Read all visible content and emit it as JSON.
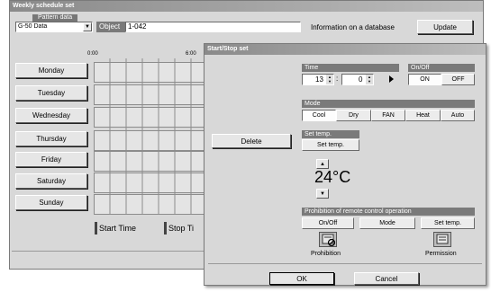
{
  "main_window": {
    "title": "Weekly schedule set",
    "pattern_label": "Pattern data",
    "pattern_value": "G-50 Data",
    "object_label": "Object",
    "object_value": "1-042",
    "info_label": "Information on a database",
    "update_label": "Update",
    "time_ticks": [
      "0:00",
      "6:00"
    ],
    "days": [
      "Monday",
      "Tuesday",
      "Wednesday",
      "Thursday",
      "Friday",
      "Saturday",
      "Sunday"
    ],
    "legend_start": "Start Time",
    "legend_stop": "Stop Ti"
  },
  "dialog": {
    "title": "Start/Stop set",
    "delete_label": "Delete",
    "time": {
      "label": "Time",
      "hour": "13",
      "minute": "0"
    },
    "onoff": {
      "label": "On/Off",
      "on": "ON",
      "off": "OFF"
    },
    "mode": {
      "label": "Mode",
      "options": [
        "Cool",
        "Dry",
        "FAN",
        "Heat",
        "Auto"
      ]
    },
    "set_temp": {
      "label": "Set temp.",
      "button": "Set temp.",
      "value": "24°C"
    },
    "prohibition": {
      "label": "Prohibition of remote control operation",
      "options": [
        "On/Off",
        "Mode",
        "Set temp."
      ],
      "prohibition_label": "Prohibition",
      "permission_label": "Permission"
    },
    "ok_label": "OK",
    "cancel_label": "Cancel"
  }
}
